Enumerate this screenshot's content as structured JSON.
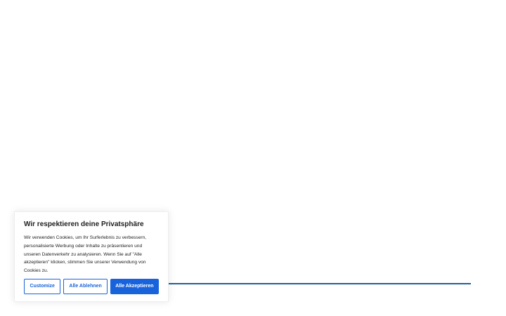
{
  "colors": {
    "accent": "#1863dc",
    "divider": "#1f5f9e",
    "text": "#212121",
    "background": "#ffffff"
  },
  "cookie_banner": {
    "title": "Wir respektieren deine Privatsphäre",
    "description": "Wir verwenden Cookies, um Ihr Surferlebnis zu verbessern, personalisierte Werbung oder Inhalte zu präsentieren und unseren Datenverkehr zu analysieren. Wenn Sie auf \"Alle akzeptieren\" klicken, stimmen Sie unserer Verwendung von Cookies zu.",
    "buttons": {
      "customize": "Customize",
      "reject": "Alle Ablehnen",
      "accept": "Alle Akzeptieren"
    }
  }
}
